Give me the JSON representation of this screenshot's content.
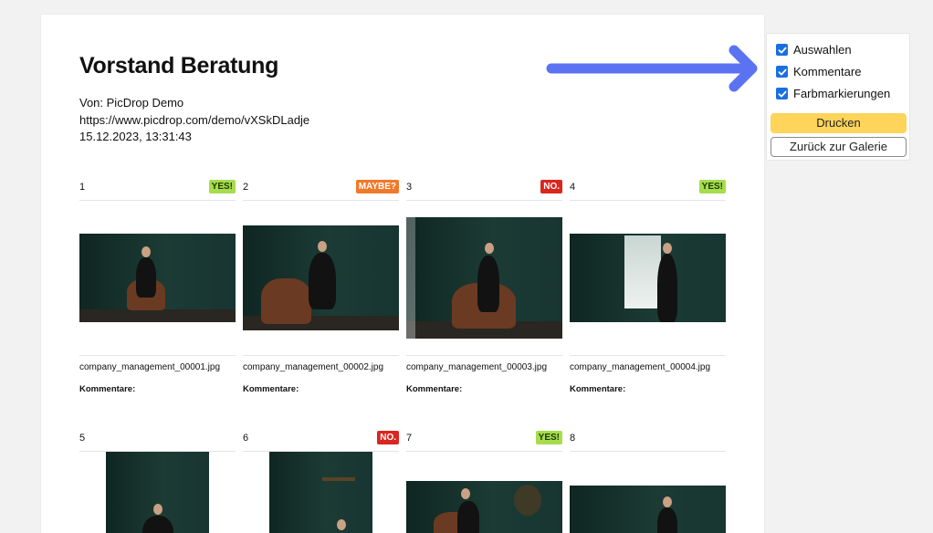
{
  "header": {
    "title": "Vorstand Beratung",
    "from": "Von: PicDrop Demo",
    "url": "https://www.picdrop.com/demo/vXSkDLadje",
    "timestamp": "15.12.2023, 13:31:43"
  },
  "panel": {
    "options": [
      {
        "label": "Auswahlen",
        "checked": true
      },
      {
        "label": "Kommentare",
        "checked": true
      },
      {
        "label": "Farbmarkierungen",
        "checked": true
      }
    ],
    "print_label": "Drucken",
    "back_label": "Zurück zur Galerie"
  },
  "items": [
    {
      "num": "1",
      "badge": "YES!",
      "badge_type": "yes",
      "file": "company_management_00001.jpg",
      "comments": "Kommentare:"
    },
    {
      "num": "2",
      "badge": "MAYBE?",
      "badge_type": "maybe",
      "file": "company_management_00002.jpg",
      "comments": "Kommentare:"
    },
    {
      "num": "3",
      "badge": "NO.",
      "badge_type": "no",
      "file": "company_management_00003.jpg",
      "comments": "Kommentare:"
    },
    {
      "num": "4",
      "badge": "YES!",
      "badge_type": "yes",
      "file": "company_management_00004.jpg",
      "comments": "Kommentare:"
    },
    {
      "num": "5",
      "badge": "",
      "badge_type": "",
      "file": "",
      "comments": ""
    },
    {
      "num": "6",
      "badge": "NO.",
      "badge_type": "no",
      "file": "",
      "comments": ""
    },
    {
      "num": "7",
      "badge": "YES!",
      "badge_type": "yes",
      "file": "",
      "comments": ""
    },
    {
      "num": "8",
      "badge": "",
      "badge_type": "",
      "file": "",
      "comments": ""
    }
  ],
  "colors": {
    "accent_arrow": "#5b73f2",
    "print_button": "#ffd45a",
    "badge_yes": "#a7dc4e",
    "badge_maybe": "#f07a2a",
    "badge_no": "#d9261e"
  }
}
